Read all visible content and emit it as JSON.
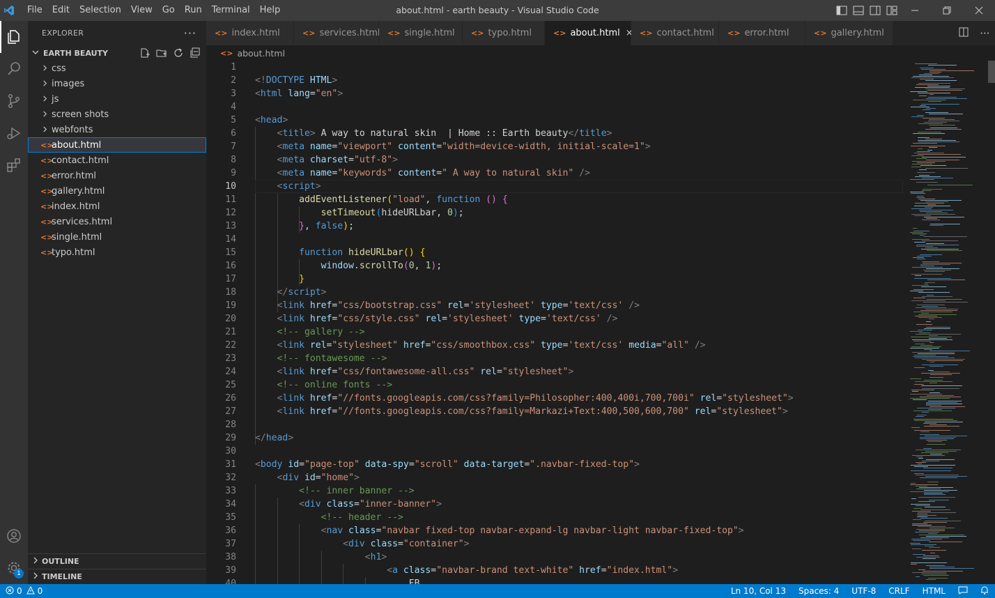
{
  "window": {
    "title": "about.html - earth beauty - Visual Studio Code",
    "menus": [
      "File",
      "Edit",
      "Selection",
      "View",
      "Go",
      "Run",
      "Terminal",
      "Help"
    ]
  },
  "sidebar": {
    "header": "EXPLORER",
    "folder": "EARTH BEAUTY",
    "folders": [
      "css",
      "images",
      "js",
      "screen shots",
      "webfonts"
    ],
    "files": [
      "about.html",
      "contact.html",
      "error.html",
      "gallery.html",
      "index.html",
      "services.html",
      "single.html",
      "typo.html"
    ],
    "selected_file": "about.html",
    "outline_label": "OUTLINE",
    "timeline_label": "TIMELINE",
    "settings_badge": "1"
  },
  "tabs": [
    {
      "label": "index.html",
      "active": false
    },
    {
      "label": "services.html",
      "active": false
    },
    {
      "label": "single.html",
      "active": false
    },
    {
      "label": "typo.html",
      "active": false
    },
    {
      "label": "about.html",
      "active": true
    },
    {
      "label": "contact.html",
      "active": false
    },
    {
      "label": "error.html",
      "active": false
    },
    {
      "label": "gallery.html",
      "active": false
    }
  ],
  "breadcrumb": "about.html",
  "editor": {
    "current_line": 10,
    "lines": [
      [],
      [
        [
          "t-br",
          "<!"
        ],
        [
          "t-tag",
          "DOCTYPE"
        ],
        [
          "t-txt",
          " "
        ],
        [
          "t-attr",
          "HTML"
        ],
        [
          "t-br",
          ">"
        ]
      ],
      [
        [
          "t-br",
          "<"
        ],
        [
          "t-tag",
          "html"
        ],
        [
          "t-txt",
          " "
        ],
        [
          "t-attr",
          "lang"
        ],
        [
          "t-txt",
          "="
        ],
        [
          "t-str",
          "\"en\""
        ],
        [
          "t-br",
          ">"
        ]
      ],
      [],
      [
        [
          "t-br",
          "<"
        ],
        [
          "t-tag",
          "head"
        ],
        [
          "t-br",
          ">"
        ]
      ],
      [
        [
          "t-txt",
          "    "
        ],
        [
          "t-br",
          "<"
        ],
        [
          "t-tag",
          "title"
        ],
        [
          "t-br",
          ">"
        ],
        [
          "t-txt",
          " A way to natural skin  | Home :: Earth beauty"
        ],
        [
          "t-br",
          "</"
        ],
        [
          "t-tag",
          "title"
        ],
        [
          "t-br",
          ">"
        ]
      ],
      [
        [
          "t-txt",
          "    "
        ],
        [
          "t-br",
          "<"
        ],
        [
          "t-tag",
          "meta"
        ],
        [
          "t-txt",
          " "
        ],
        [
          "t-attr",
          "name"
        ],
        [
          "t-txt",
          "="
        ],
        [
          "t-str",
          "\"viewport\""
        ],
        [
          "t-txt",
          " "
        ],
        [
          "t-attr",
          "content"
        ],
        [
          "t-txt",
          "="
        ],
        [
          "t-str",
          "\"width=device-width, initial-scale=1\""
        ],
        [
          "t-br",
          ">"
        ]
      ],
      [
        [
          "t-txt",
          "    "
        ],
        [
          "t-br",
          "<"
        ],
        [
          "t-tag",
          "meta"
        ],
        [
          "t-txt",
          " "
        ],
        [
          "t-attr",
          "charset"
        ],
        [
          "t-txt",
          "="
        ],
        [
          "t-str",
          "\"utf-8\""
        ],
        [
          "t-br",
          ">"
        ]
      ],
      [
        [
          "t-txt",
          "    "
        ],
        [
          "t-br",
          "<"
        ],
        [
          "t-tag",
          "meta"
        ],
        [
          "t-txt",
          " "
        ],
        [
          "t-attr",
          "name"
        ],
        [
          "t-txt",
          "="
        ],
        [
          "t-str",
          "\"keywords\""
        ],
        [
          "t-txt",
          " "
        ],
        [
          "t-attr",
          "content"
        ],
        [
          "t-txt",
          "="
        ],
        [
          "t-str",
          "\" A way to natural skin\""
        ],
        [
          "t-txt",
          " "
        ],
        [
          "t-br",
          "/>"
        ]
      ],
      [
        [
          "t-txt",
          "    "
        ],
        [
          "t-br",
          "<"
        ],
        [
          "t-tag",
          "script"
        ],
        [
          "t-br",
          ">"
        ]
      ],
      [
        [
          "t-txt",
          "        "
        ],
        [
          "t-fn",
          "addEventListener"
        ],
        [
          "t-br1",
          "("
        ],
        [
          "t-str",
          "\"load\""
        ],
        [
          "t-txt",
          ", "
        ],
        [
          "t-kw",
          "function"
        ],
        [
          "t-txt",
          " "
        ],
        [
          "t-br2",
          "()"
        ],
        [
          "t-txt",
          " "
        ],
        [
          "t-br2",
          "{"
        ]
      ],
      [
        [
          "t-txt",
          "            "
        ],
        [
          "t-fn",
          "setTimeout"
        ],
        [
          "t-br3",
          "("
        ],
        [
          "t-txt",
          "hideURLbar, "
        ],
        [
          "t-num",
          "0"
        ],
        [
          "t-br3",
          ")"
        ],
        [
          "t-txt",
          ";"
        ]
      ],
      [
        [
          "t-txt",
          "        "
        ],
        [
          "t-br2",
          "}"
        ],
        [
          "t-txt",
          ", "
        ],
        [
          "t-kw",
          "false"
        ],
        [
          "t-br1",
          ")"
        ],
        [
          "t-txt",
          ";"
        ]
      ],
      [],
      [
        [
          "t-txt",
          "        "
        ],
        [
          "t-kw",
          "function"
        ],
        [
          "t-txt",
          " "
        ],
        [
          "t-fn",
          "hideURLbar"
        ],
        [
          "t-br1",
          "()"
        ],
        [
          "t-txt",
          " "
        ],
        [
          "t-br1",
          "{"
        ]
      ],
      [
        [
          "t-txt",
          "            "
        ],
        [
          "t-attr",
          "window"
        ],
        [
          "t-txt",
          "."
        ],
        [
          "t-fn",
          "scrollTo"
        ],
        [
          "t-br2",
          "("
        ],
        [
          "t-num",
          "0"
        ],
        [
          "t-txt",
          ", "
        ],
        [
          "t-num",
          "1"
        ],
        [
          "t-br2",
          ")"
        ],
        [
          "t-txt",
          ";"
        ]
      ],
      [
        [
          "t-txt",
          "        "
        ],
        [
          "t-br1",
          "}"
        ]
      ],
      [
        [
          "t-txt",
          "    "
        ],
        [
          "t-br",
          "</"
        ],
        [
          "t-tag",
          "script"
        ],
        [
          "t-br",
          ">"
        ]
      ],
      [
        [
          "t-txt",
          "    "
        ],
        [
          "t-br",
          "<"
        ],
        [
          "t-tag",
          "link"
        ],
        [
          "t-txt",
          " "
        ],
        [
          "t-attr",
          "href"
        ],
        [
          "t-txt",
          "="
        ],
        [
          "t-str",
          "\"css/bootstrap.css\""
        ],
        [
          "t-txt",
          " "
        ],
        [
          "t-attr",
          "rel"
        ],
        [
          "t-txt",
          "="
        ],
        [
          "t-str",
          "'stylesheet'"
        ],
        [
          "t-txt",
          " "
        ],
        [
          "t-attr",
          "type"
        ],
        [
          "t-txt",
          "="
        ],
        [
          "t-str",
          "'text/css'"
        ],
        [
          "t-txt",
          " "
        ],
        [
          "t-br",
          "/>"
        ]
      ],
      [
        [
          "t-txt",
          "    "
        ],
        [
          "t-br",
          "<"
        ],
        [
          "t-tag",
          "link"
        ],
        [
          "t-txt",
          " "
        ],
        [
          "t-attr",
          "href"
        ],
        [
          "t-txt",
          "="
        ],
        [
          "t-str",
          "\"css/style.css\""
        ],
        [
          "t-txt",
          " "
        ],
        [
          "t-attr",
          "rel"
        ],
        [
          "t-txt",
          "="
        ],
        [
          "t-str",
          "'stylesheet'"
        ],
        [
          "t-txt",
          " "
        ],
        [
          "t-attr",
          "type"
        ],
        [
          "t-txt",
          "="
        ],
        [
          "t-str",
          "'text/css'"
        ],
        [
          "t-txt",
          " "
        ],
        [
          "t-br",
          "/>"
        ]
      ],
      [
        [
          "t-txt",
          "    "
        ],
        [
          "t-com",
          "<!-- gallery -->"
        ]
      ],
      [
        [
          "t-txt",
          "    "
        ],
        [
          "t-br",
          "<"
        ],
        [
          "t-tag",
          "link"
        ],
        [
          "t-txt",
          " "
        ],
        [
          "t-attr",
          "rel"
        ],
        [
          "t-txt",
          "="
        ],
        [
          "t-str",
          "\"stylesheet\""
        ],
        [
          "t-txt",
          " "
        ],
        [
          "t-attr",
          "href"
        ],
        [
          "t-txt",
          "="
        ],
        [
          "t-str",
          "\"css/smoothbox.css\""
        ],
        [
          "t-txt",
          " "
        ],
        [
          "t-attr",
          "type"
        ],
        [
          "t-txt",
          "="
        ],
        [
          "t-str",
          "'text/css'"
        ],
        [
          "t-txt",
          " "
        ],
        [
          "t-attr",
          "media"
        ],
        [
          "t-txt",
          "="
        ],
        [
          "t-str",
          "\"all\""
        ],
        [
          "t-txt",
          " "
        ],
        [
          "t-br",
          "/>"
        ]
      ],
      [
        [
          "t-txt",
          "    "
        ],
        [
          "t-com",
          "<!-- fontawesome -->"
        ]
      ],
      [
        [
          "t-txt",
          "    "
        ],
        [
          "t-br",
          "<"
        ],
        [
          "t-tag",
          "link"
        ],
        [
          "t-txt",
          " "
        ],
        [
          "t-attr",
          "href"
        ],
        [
          "t-txt",
          "="
        ],
        [
          "t-str",
          "\"css/fontawesome-all.css\""
        ],
        [
          "t-txt",
          " "
        ],
        [
          "t-attr",
          "rel"
        ],
        [
          "t-txt",
          "="
        ],
        [
          "t-str",
          "\"stylesheet\""
        ],
        [
          "t-br",
          ">"
        ]
      ],
      [
        [
          "t-txt",
          "    "
        ],
        [
          "t-com",
          "<!-- online fonts -->"
        ]
      ],
      [
        [
          "t-txt",
          "    "
        ],
        [
          "t-br",
          "<"
        ],
        [
          "t-tag",
          "link"
        ],
        [
          "t-txt",
          " "
        ],
        [
          "t-attr",
          "href"
        ],
        [
          "t-txt",
          "="
        ],
        [
          "t-str",
          "\"//fonts.googleapis.com/css?family=Philosopher:400,400i,700,700i\""
        ],
        [
          "t-txt",
          " "
        ],
        [
          "t-attr",
          "rel"
        ],
        [
          "t-txt",
          "="
        ],
        [
          "t-str",
          "\"stylesheet\""
        ],
        [
          "t-br",
          ">"
        ]
      ],
      [
        [
          "t-txt",
          "    "
        ],
        [
          "t-br",
          "<"
        ],
        [
          "t-tag",
          "link"
        ],
        [
          "t-txt",
          " "
        ],
        [
          "t-attr",
          "href"
        ],
        [
          "t-txt",
          "="
        ],
        [
          "t-str",
          "\"//fonts.googleapis.com/css?family=Markazi+Text:400,500,600,700\""
        ],
        [
          "t-txt",
          " "
        ],
        [
          "t-attr",
          "rel"
        ],
        [
          "t-txt",
          "="
        ],
        [
          "t-str",
          "\"stylesheet\""
        ],
        [
          "t-br",
          ">"
        ]
      ],
      [],
      [
        [
          "t-br",
          "</"
        ],
        [
          "t-tag",
          "head"
        ],
        [
          "t-br",
          ">"
        ]
      ],
      [],
      [
        [
          "t-br",
          "<"
        ],
        [
          "t-tag",
          "body"
        ],
        [
          "t-txt",
          " "
        ],
        [
          "t-attr",
          "id"
        ],
        [
          "t-txt",
          "="
        ],
        [
          "t-str",
          "\"page-top\""
        ],
        [
          "t-txt",
          " "
        ],
        [
          "t-attr",
          "data-spy"
        ],
        [
          "t-txt",
          "="
        ],
        [
          "t-str",
          "\"scroll\""
        ],
        [
          "t-txt",
          " "
        ],
        [
          "t-attr",
          "data-target"
        ],
        [
          "t-txt",
          "="
        ],
        [
          "t-str",
          "\".navbar-fixed-top\""
        ],
        [
          "t-br",
          ">"
        ]
      ],
      [
        [
          "t-txt",
          "    "
        ],
        [
          "t-br",
          "<"
        ],
        [
          "t-tag",
          "div"
        ],
        [
          "t-txt",
          " "
        ],
        [
          "t-attr",
          "id"
        ],
        [
          "t-txt",
          "="
        ],
        [
          "t-str",
          "\"home\""
        ],
        [
          "t-br",
          ">"
        ]
      ],
      [
        [
          "t-txt",
          "        "
        ],
        [
          "t-com",
          "<!-- inner banner -->"
        ]
      ],
      [
        [
          "t-txt",
          "        "
        ],
        [
          "t-br",
          "<"
        ],
        [
          "t-tag",
          "div"
        ],
        [
          "t-txt",
          " "
        ],
        [
          "t-attr",
          "class"
        ],
        [
          "t-txt",
          "="
        ],
        [
          "t-str",
          "\"inner-banner\""
        ],
        [
          "t-br",
          ">"
        ]
      ],
      [
        [
          "t-txt",
          "            "
        ],
        [
          "t-com",
          "<!-- header -->"
        ]
      ],
      [
        [
          "t-txt",
          "            "
        ],
        [
          "t-br",
          "<"
        ],
        [
          "t-tag",
          "nav"
        ],
        [
          "t-txt",
          " "
        ],
        [
          "t-attr",
          "class"
        ],
        [
          "t-txt",
          "="
        ],
        [
          "t-str",
          "\"navbar fixed-top navbar-expand-lg navbar-light navbar-fixed-top\""
        ],
        [
          "t-br",
          ">"
        ]
      ],
      [
        [
          "t-txt",
          "                "
        ],
        [
          "t-br",
          "<"
        ],
        [
          "t-tag",
          "div"
        ],
        [
          "t-txt",
          " "
        ],
        [
          "t-attr",
          "class"
        ],
        [
          "t-txt",
          "="
        ],
        [
          "t-str",
          "\"container\""
        ],
        [
          "t-br",
          ">"
        ]
      ],
      [
        [
          "t-txt",
          "                    "
        ],
        [
          "t-br",
          "<"
        ],
        [
          "t-tag",
          "h1"
        ],
        [
          "t-br",
          ">"
        ]
      ],
      [
        [
          "t-txt",
          "                        "
        ],
        [
          "t-br",
          "<"
        ],
        [
          "t-tag",
          "a"
        ],
        [
          "t-txt",
          " "
        ],
        [
          "t-attr",
          "class"
        ],
        [
          "t-txt",
          "="
        ],
        [
          "t-str",
          "\"navbar-brand text-white\""
        ],
        [
          "t-txt",
          " "
        ],
        [
          "t-attr",
          "href"
        ],
        [
          "t-txt",
          "="
        ],
        [
          "t-str",
          "\"index.html\""
        ],
        [
          "t-br",
          ">"
        ]
      ],
      [
        [
          "t-txt",
          "                            EB"
        ]
      ]
    ]
  },
  "statusbar": {
    "errors": "0",
    "warnings": "0",
    "position": "Ln 10, Col 13",
    "spaces": "Spaces: 4",
    "encoding": "UTF-8",
    "eol": "CRLF",
    "language": "HTML"
  },
  "colors": {
    "accent": "#007acc",
    "html_file_icon": "#e37933"
  }
}
